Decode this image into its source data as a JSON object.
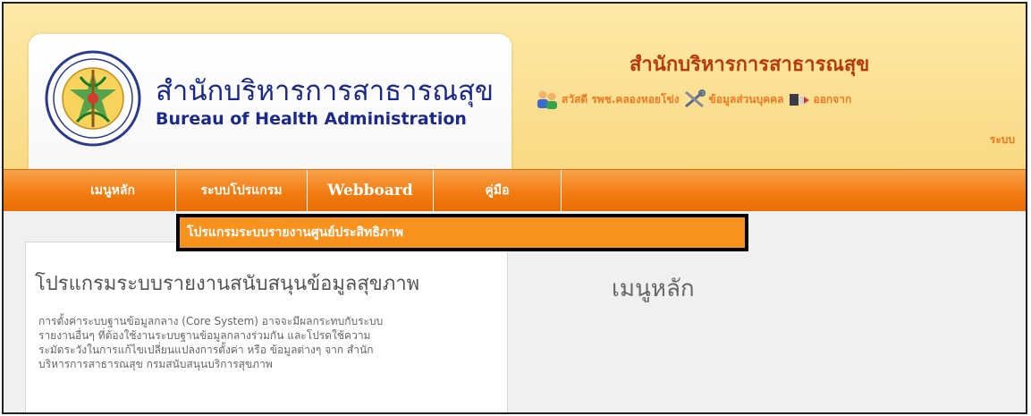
{
  "brand": {
    "thai_name": "สำนักบริหารการสาธารณสุข",
    "english_name": "Bureau of Health Administration"
  },
  "header": {
    "site_title": "สำนักบริหารการสาธารณสุข",
    "greeting": "สวัสดี รพช.คลองหอยโข่ง",
    "profile_label": "ข้อมูลส่วนบุคคล",
    "logout_label_part1": "ออกจาก",
    "logout_label_part2": "ระบบ"
  },
  "nav": {
    "items": [
      {
        "label": "เมนูหลัก"
      },
      {
        "label": "ระบบโปรแกรม"
      },
      {
        "label": "Webboard"
      },
      {
        "label": "คู่มือ"
      }
    ],
    "dropdown": {
      "items": [
        {
          "label": "โปรแกรมระบบรายงานศูนย์ประสิทธิภาพ"
        }
      ]
    }
  },
  "left_panel": {
    "title": "โปรแกรมระบบรายงานสนับสนุนข้อมูลสุขภาพ",
    "description": "การตั้งค่าระบบฐานข้อมูลกลาง (Core System) อาจจะมีผลกระทบกับระบบรายงานอื่นๆ ที่ต้องใช้งานระบบฐานข้อมูลกลางร่วมกัน และโปรดใช้ความระมัดระวังในการแก้ไขเปลี่ยนแปลงการตั้งค่า หรือ ข้อมูลต่างๆ จาก สำนักบริหารการสาธารณสุข กรมสนับสนุนบริการสุขภาพ"
  },
  "main": {
    "title": "เมนูหลัก"
  },
  "icons": {
    "seal": "ministry-seal-icon",
    "users": "users-icon",
    "tools": "tools-icon",
    "logout": "logout-icon"
  },
  "colors": {
    "nav_orange": "#f27d12",
    "header_yellow": "#fde9a8",
    "title_red": "#b83a0a",
    "brand_blue": "#1b2a8a",
    "link_orange": "#f07820"
  }
}
